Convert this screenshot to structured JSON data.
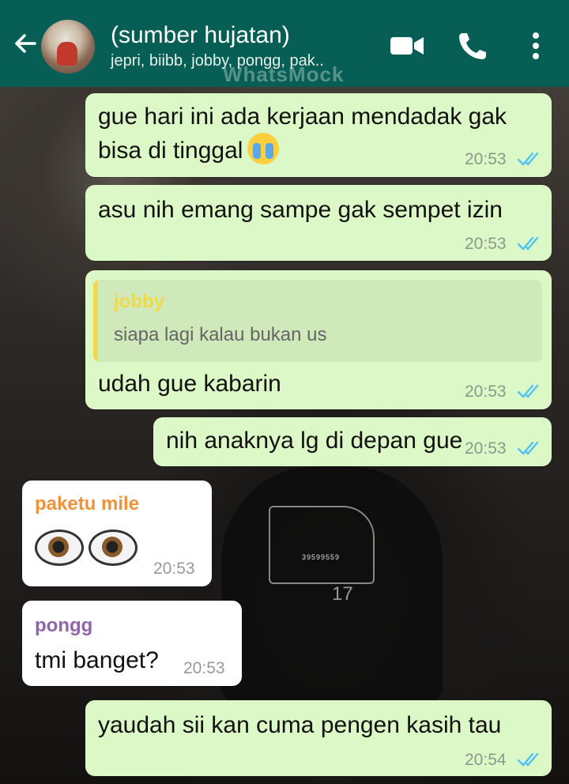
{
  "header": {
    "title": "(sumber hujatan)",
    "subtitle": "jepri, biibb, jobby, pongg, pak..",
    "watermark": "WhatsMock"
  },
  "messages": [
    {
      "type": "out",
      "text_line1": "gue hari ini ada kerjaan mendadak gak",
      "text_line2": "bisa di tinggal",
      "emoji": "loudly-crying-face",
      "time": "20:53"
    },
    {
      "type": "out",
      "text": "asu nih emang sampe gak sempet izin",
      "time": "20:53"
    },
    {
      "type": "out",
      "quote": {
        "name": "jobby",
        "text": "siapa lagi kalau bukan us"
      },
      "text": "udah gue kabarin",
      "time": "20:53"
    },
    {
      "type": "out",
      "text": "nih anaknya lg di depan gue",
      "time": "20:53"
    },
    {
      "type": "in",
      "sender": "paketu mile",
      "sender_color": "#f0923a",
      "emoji": "eyes",
      "time": "20:53"
    },
    {
      "type": "in",
      "sender": "pongg",
      "sender_color": "#8e66a8",
      "text": "tmi banget?",
      "time": "20:53"
    },
    {
      "type": "out",
      "text": "yaudah sii kan cuma pengen kasih tau",
      "time": "20:54"
    }
  ],
  "wallpaper": {
    "shirt_number": "17",
    "shirt_code": "39599559"
  },
  "colors": {
    "header": "#075e54",
    "outgoing": "#dcf8c6",
    "incoming": "#ffffff",
    "ticks": "#4fc3f7"
  }
}
